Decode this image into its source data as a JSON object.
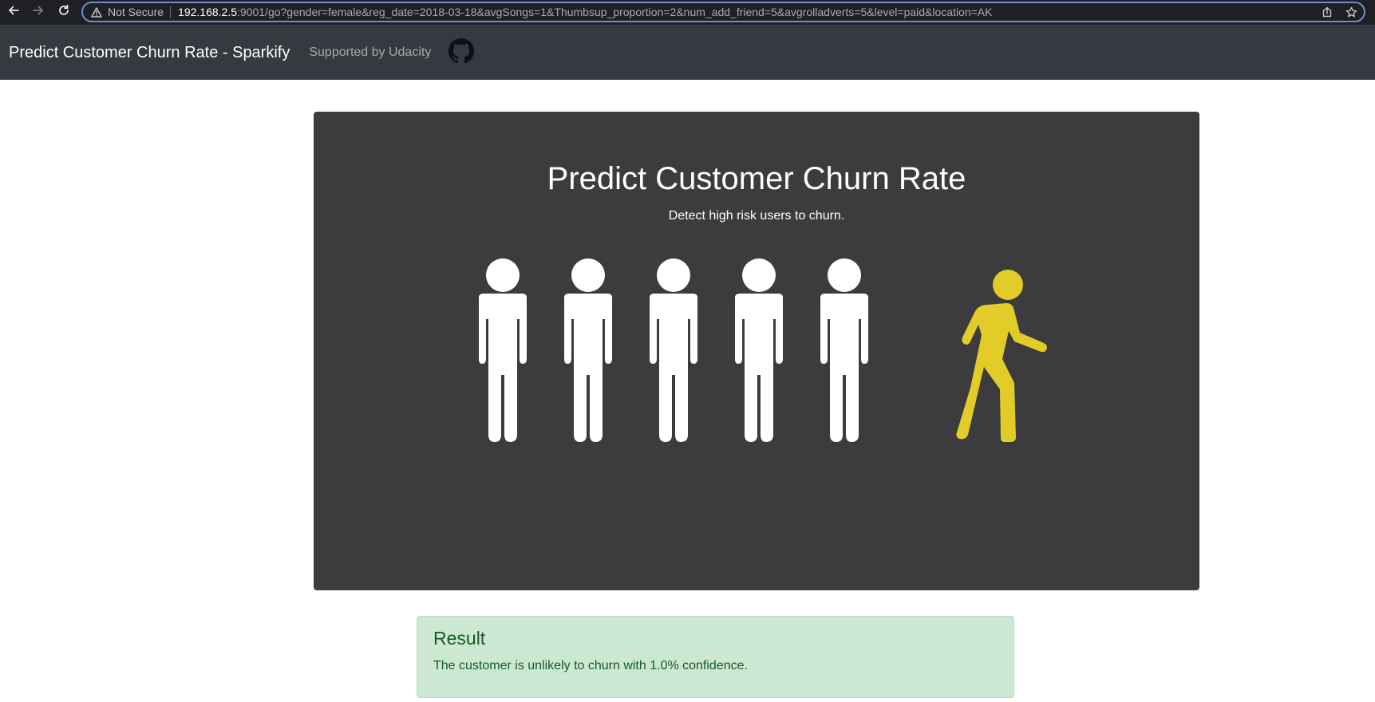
{
  "browser": {
    "security_label": "Not Secure",
    "url_host": "192.168.2.5",
    "url_rest": ":9001/go?gender=female&reg_date=2018-03-18&avgSongs=1&Thumbsup_proportion=2&num_add_friend=5&avgrolladverts=5&level=paid&location=AK"
  },
  "navbar": {
    "brand": "Predict Customer Churn Rate - Sparkify",
    "link": "Supported by Udacity",
    "icon": "github-icon"
  },
  "hero": {
    "title": "Predict Customer Churn Rate",
    "subtitle": "Detect high risk users to churn.",
    "figure_colors": {
      "standing": "#ffffff",
      "walking": "#e2cc28"
    }
  },
  "result": {
    "heading": "Result",
    "message": "The customer is unlikely to churn with 1.0% confidence."
  },
  "colors": {
    "navbar_bg": "#343a40",
    "jumbotron_bg": "#3c3b3e",
    "alert_bg": "#cce8d2",
    "alert_text": "#165926"
  }
}
